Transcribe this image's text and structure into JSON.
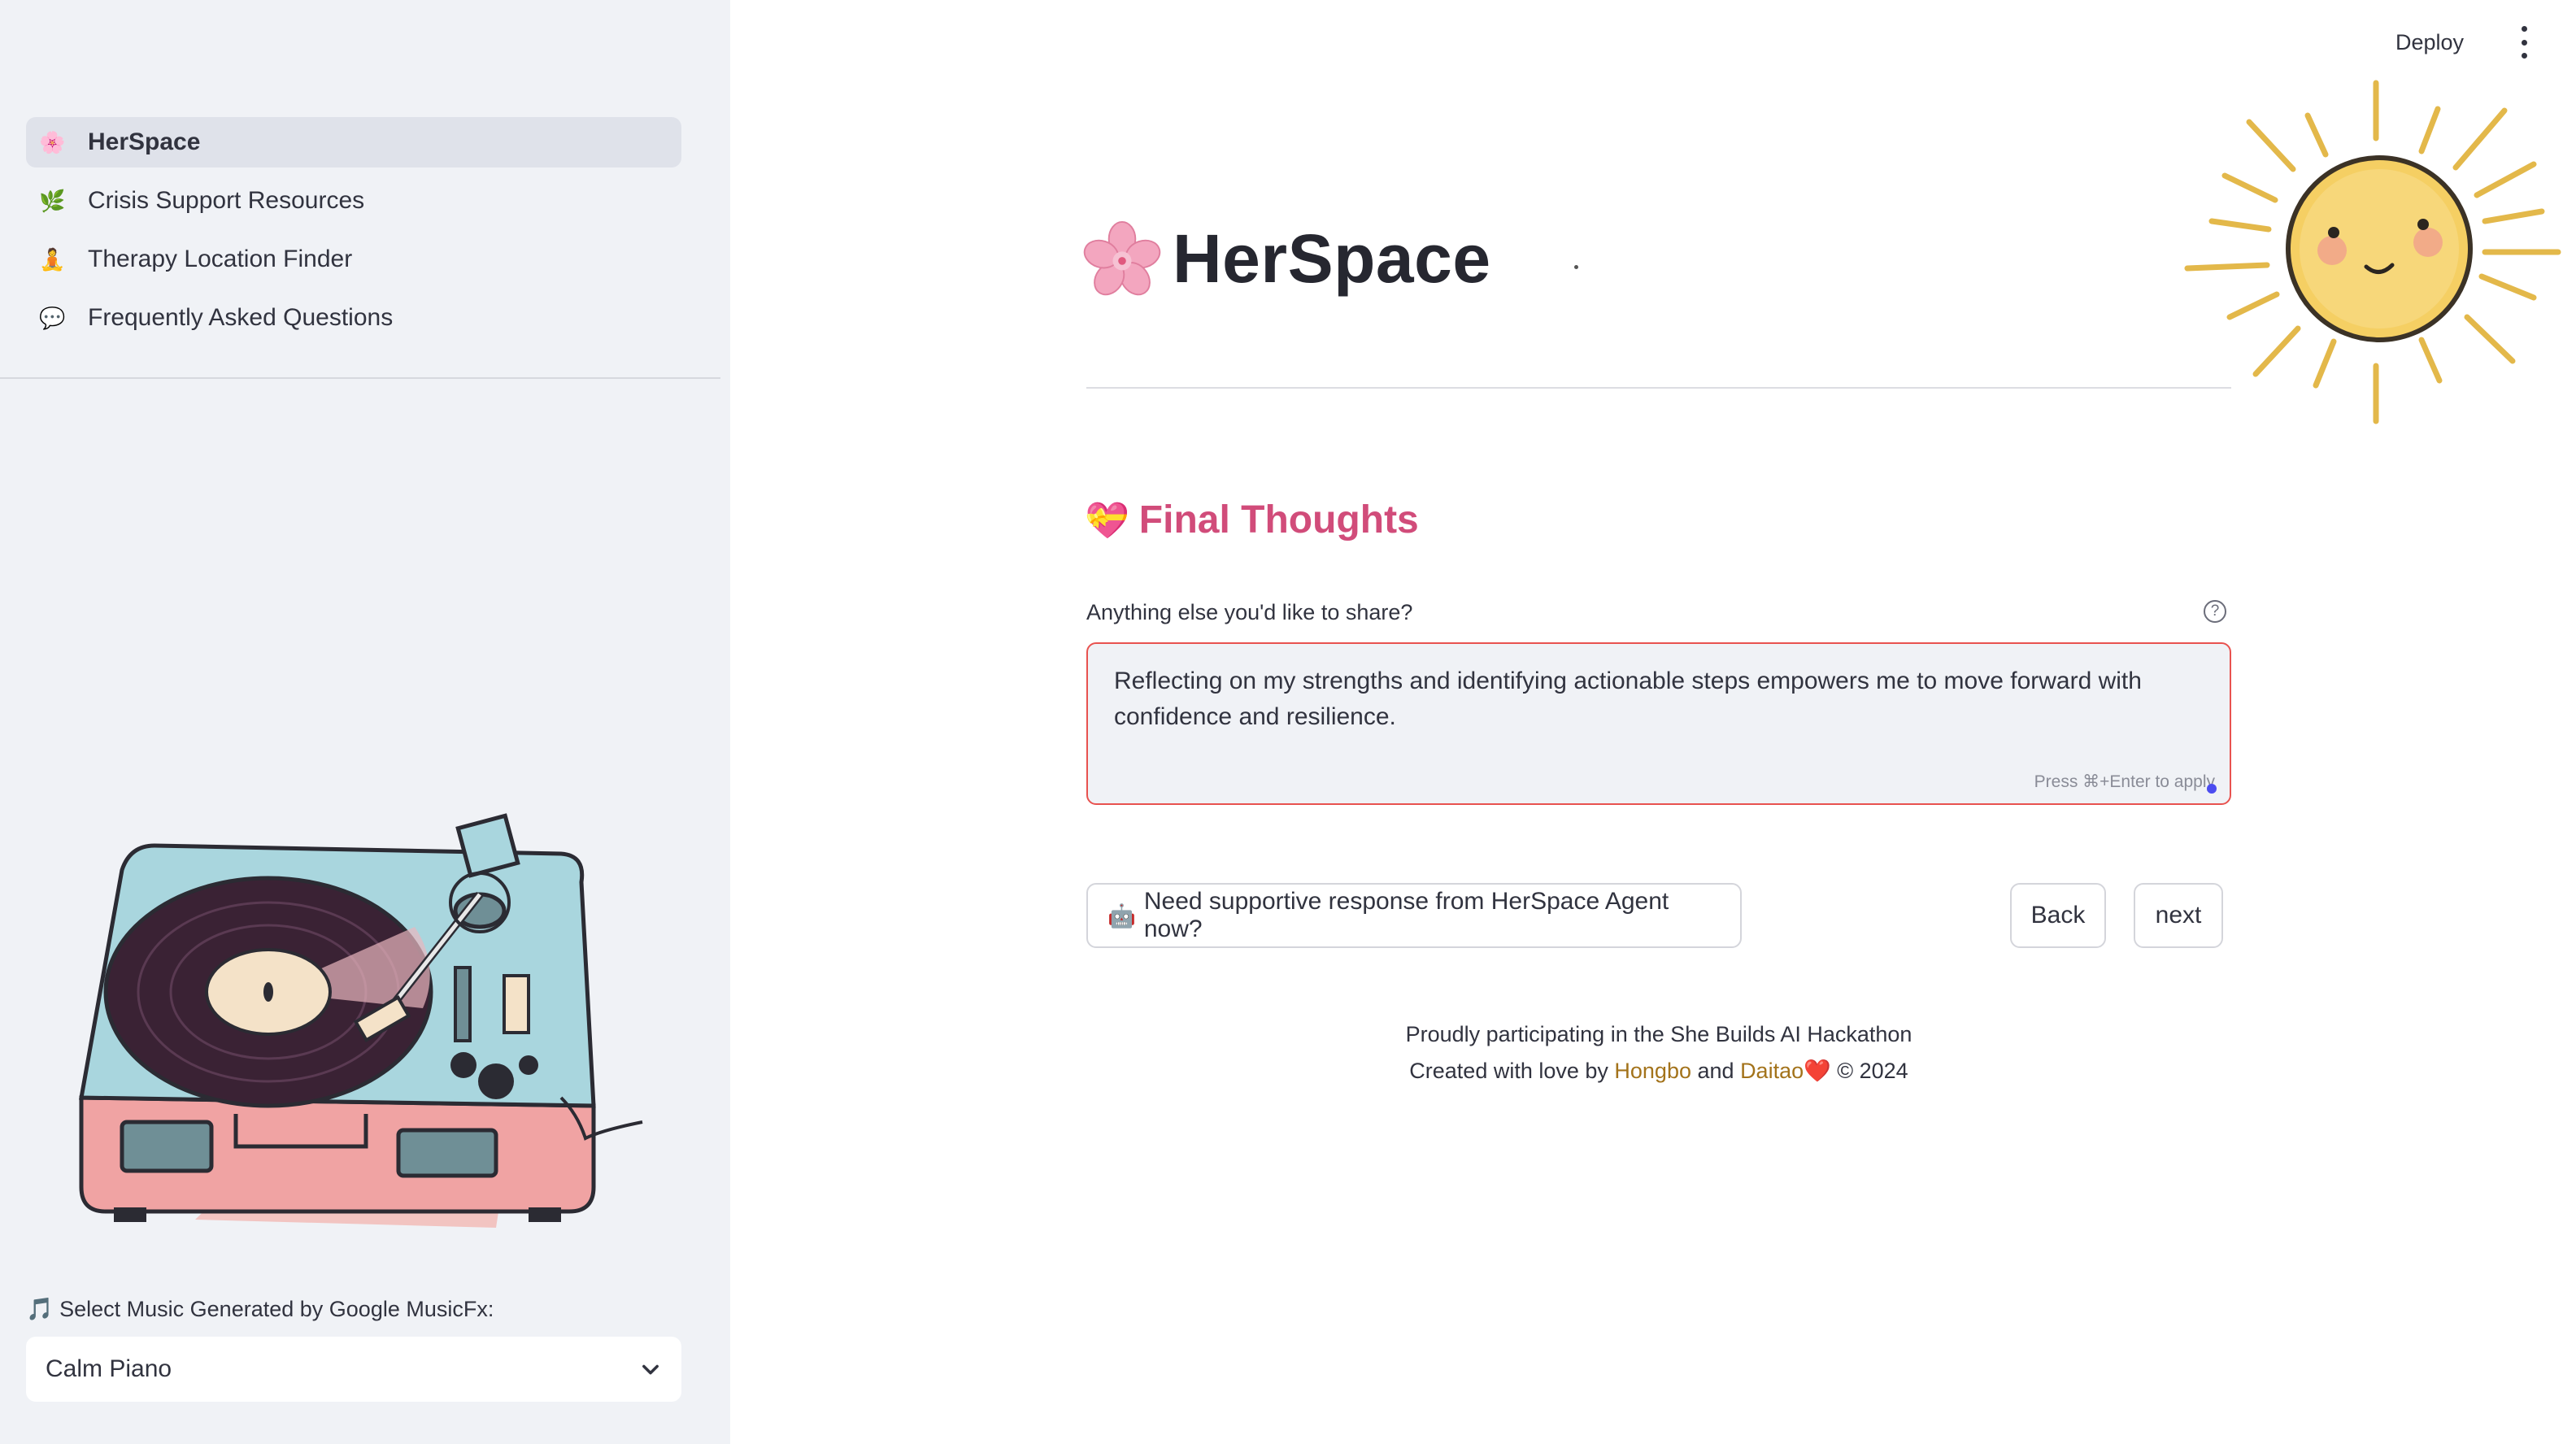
{
  "sidebar": {
    "nav": [
      {
        "icon": "🌸",
        "label": "HerSpace",
        "active": true
      },
      {
        "icon": "🌿",
        "label": "Crisis Support Resources"
      },
      {
        "icon": "🧘",
        "label": "Therapy Location Finder"
      },
      {
        "icon": "💬",
        "label": "Frequently Asked Questions"
      }
    ],
    "music": {
      "label": "🎵 Select Music Generated by Google MusicFx:",
      "selected": "Calm Piano"
    }
  },
  "header": {
    "deploy_label": "Deploy"
  },
  "main": {
    "title": "HerSpace",
    "section_icon": "💝",
    "section_title": "Final Thoughts",
    "field_label": "Anything else you'd like to share?",
    "help_glyph": "?",
    "textarea_value": "Reflecting on my strengths and identifying actionable steps empowers me to move forward with confidence and resilience.",
    "textarea_hint": "Press ⌘+Enter to apply",
    "agent_button_icon": "🤖",
    "agent_button_label": "Need supportive response from HerSpace Agent now?",
    "back_label": "Back",
    "next_label": "next"
  },
  "footer": {
    "line1": "Proudly participating in the She Builds AI Hackathon",
    "prefix": "Created with love by ",
    "author1": "Hongbo",
    "and": " and ",
    "author2": "Daitao",
    "heart": "❤️",
    "copyright": " © 2024"
  },
  "colors": {
    "accent_pink": "#d14c7a",
    "link_gold": "#a3731b",
    "error_border": "#e8524f",
    "sidebar_bg": "#f0f2f6"
  }
}
